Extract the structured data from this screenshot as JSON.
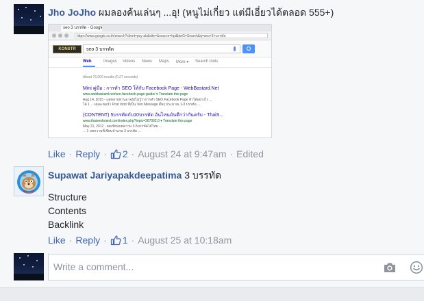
{
  "comment1": {
    "author": "Jho JoJho",
    "text": "ผมลองค้นเล่นๆ ...อุ! (หนูไม่เกี่ยว แต่มีเอี่ยวได้ตลอด 555+)",
    "actions": {
      "like": "Like",
      "reply": "Reply",
      "like_count": "2",
      "timestamp": "August 24 at 9:47am",
      "edited": "Edited"
    }
  },
  "screenshot": {
    "tab_title": "seo 3 บรรทัด - Google",
    "url": "https://www.google.co.th/search?client=psy-ab&site=&source=hp&btnG=Search&q=seo+3+บรรทัด",
    "logo": "KONSTR",
    "query": "seo 3 บรรทัด",
    "tabs": [
      "Web",
      "Images",
      "Videos",
      "News",
      "Maps",
      "More ▾",
      "Search tools"
    ],
    "stats": "About 76,000 results (0.27 seconds)",
    "results": [
      {
        "title": "Mini คู่มือ : การทำ SEO ให้กับ Facebook Page - WebBastard.Net",
        "url": "www.webbastard.net/seo-facebook-page-guide/ ▾ Translate this page",
        "snippet1": "Aug 14, 2015 - แต่หลายท่านอาจยังไม่รู้ว่าการทำ SEO Facebook Page ทำได้อย่างไร ...",
        "snippet2": "ได้ 1 ... ผมจะขอนำ Post Intro ที่เป็น Text Message สั้นๆ ประมาณ 1-3 บรรทัด ..."
      },
      {
        "title": "(CONTENT) 5บรรทัดกับ10บรรทัด อันไหนมันดีกว่ากันครับ - ThaiS...",
        "url": "www.thaiseoboard.com/index.php?topic=267062.0 ▾ Translate this page",
        "snippet1": "May 21, 2012 - ผมเขียนบทความ 3-5บรรทัดได้ไหม ...",
        "snippet2": "... 1 บทความที่เขียนจำนวน 3 บรรทัด ..."
      }
    ]
  },
  "comment2": {
    "author": "Supawat Jariyapakdeepatima",
    "text_inline": "3 บรรทัด",
    "lines": [
      "Structure",
      "Contents",
      "Backlink"
    ],
    "actions": {
      "like": "Like",
      "reply": "Reply",
      "like_count": "1",
      "timestamp": "August 25 at 10:18am"
    }
  },
  "composer": {
    "placeholder": "Write a comment...",
    "camera_icon": "camera-icon",
    "emoji_icon": "smiley-icon"
  },
  "colors": {
    "link": "#4267b2",
    "name": "#365899",
    "meta": "#90949c"
  }
}
